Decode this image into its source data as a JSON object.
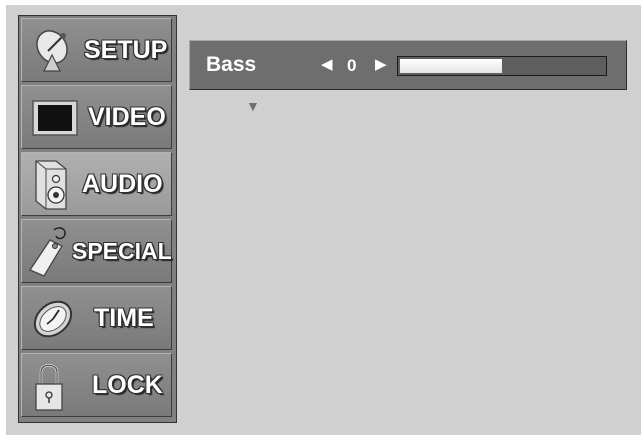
{
  "menu": {
    "items": [
      {
        "label": "SETUP",
        "icon": "satellite-dish-icon"
      },
      {
        "label": "VIDEO",
        "icon": "tv-screen-icon"
      },
      {
        "label": "AUDIO",
        "icon": "speaker-icon",
        "selected": true
      },
      {
        "label": "SPECIAL",
        "icon": "tag-icon"
      },
      {
        "label": "TIME",
        "icon": "clock-icon"
      },
      {
        "label": "LOCK",
        "icon": "padlock-icon"
      }
    ]
  },
  "audio": {
    "bass_label": "Bass",
    "bass_value": "0",
    "slider_level": 0.5,
    "left_arrow": "◀",
    "right_arrow": "▶",
    "more_indicator": "▼"
  }
}
